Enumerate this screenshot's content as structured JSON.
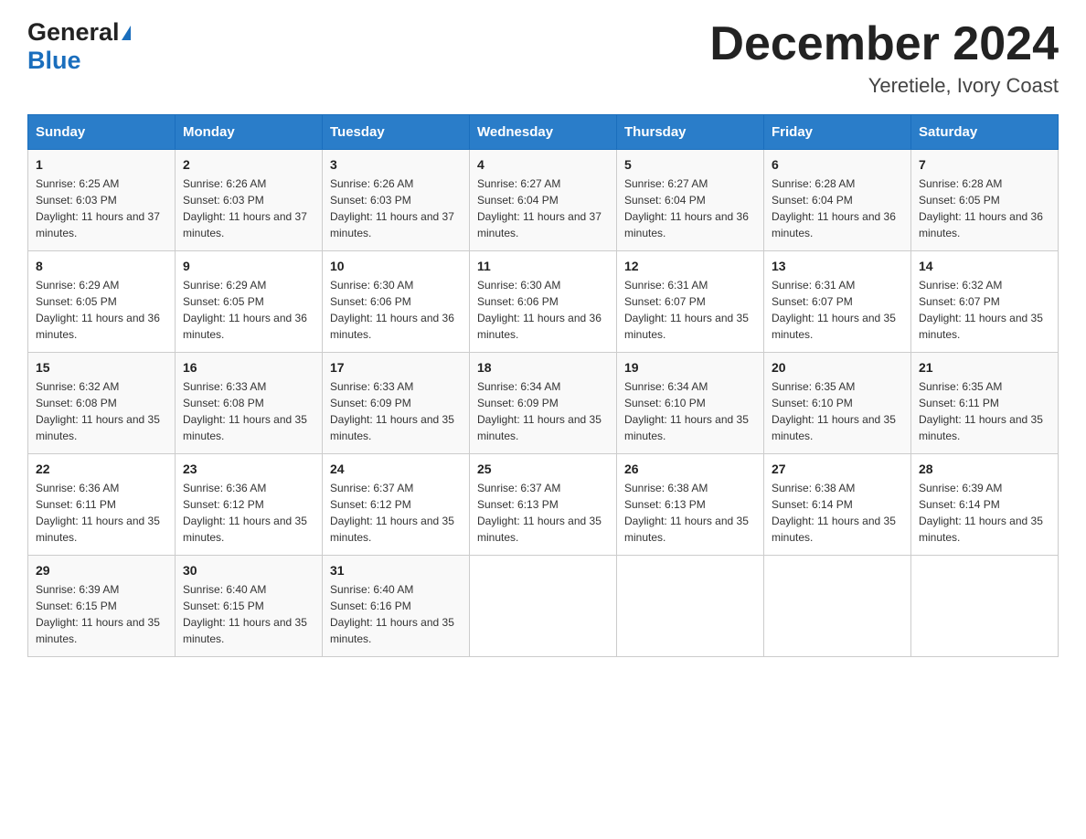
{
  "header": {
    "title": "December 2024",
    "location": "Yeretiele, Ivory Coast",
    "logo_general": "General",
    "logo_blue": "Blue"
  },
  "days_of_week": [
    "Sunday",
    "Monday",
    "Tuesday",
    "Wednesday",
    "Thursday",
    "Friday",
    "Saturday"
  ],
  "weeks": [
    [
      {
        "day": "1",
        "sunrise": "6:25 AM",
        "sunset": "6:03 PM",
        "daylight": "11 hours and 37 minutes."
      },
      {
        "day": "2",
        "sunrise": "6:26 AM",
        "sunset": "6:03 PM",
        "daylight": "11 hours and 37 minutes."
      },
      {
        "day": "3",
        "sunrise": "6:26 AM",
        "sunset": "6:03 PM",
        "daylight": "11 hours and 37 minutes."
      },
      {
        "day": "4",
        "sunrise": "6:27 AM",
        "sunset": "6:04 PM",
        "daylight": "11 hours and 37 minutes."
      },
      {
        "day": "5",
        "sunrise": "6:27 AM",
        "sunset": "6:04 PM",
        "daylight": "11 hours and 36 minutes."
      },
      {
        "day": "6",
        "sunrise": "6:28 AM",
        "sunset": "6:04 PM",
        "daylight": "11 hours and 36 minutes."
      },
      {
        "day": "7",
        "sunrise": "6:28 AM",
        "sunset": "6:05 PM",
        "daylight": "11 hours and 36 minutes."
      }
    ],
    [
      {
        "day": "8",
        "sunrise": "6:29 AM",
        "sunset": "6:05 PM",
        "daylight": "11 hours and 36 minutes."
      },
      {
        "day": "9",
        "sunrise": "6:29 AM",
        "sunset": "6:05 PM",
        "daylight": "11 hours and 36 minutes."
      },
      {
        "day": "10",
        "sunrise": "6:30 AM",
        "sunset": "6:06 PM",
        "daylight": "11 hours and 36 minutes."
      },
      {
        "day": "11",
        "sunrise": "6:30 AM",
        "sunset": "6:06 PM",
        "daylight": "11 hours and 36 minutes."
      },
      {
        "day": "12",
        "sunrise": "6:31 AM",
        "sunset": "6:07 PM",
        "daylight": "11 hours and 35 minutes."
      },
      {
        "day": "13",
        "sunrise": "6:31 AM",
        "sunset": "6:07 PM",
        "daylight": "11 hours and 35 minutes."
      },
      {
        "day": "14",
        "sunrise": "6:32 AM",
        "sunset": "6:07 PM",
        "daylight": "11 hours and 35 minutes."
      }
    ],
    [
      {
        "day": "15",
        "sunrise": "6:32 AM",
        "sunset": "6:08 PM",
        "daylight": "11 hours and 35 minutes."
      },
      {
        "day": "16",
        "sunrise": "6:33 AM",
        "sunset": "6:08 PM",
        "daylight": "11 hours and 35 minutes."
      },
      {
        "day": "17",
        "sunrise": "6:33 AM",
        "sunset": "6:09 PM",
        "daylight": "11 hours and 35 minutes."
      },
      {
        "day": "18",
        "sunrise": "6:34 AM",
        "sunset": "6:09 PM",
        "daylight": "11 hours and 35 minutes."
      },
      {
        "day": "19",
        "sunrise": "6:34 AM",
        "sunset": "6:10 PM",
        "daylight": "11 hours and 35 minutes."
      },
      {
        "day": "20",
        "sunrise": "6:35 AM",
        "sunset": "6:10 PM",
        "daylight": "11 hours and 35 minutes."
      },
      {
        "day": "21",
        "sunrise": "6:35 AM",
        "sunset": "6:11 PM",
        "daylight": "11 hours and 35 minutes."
      }
    ],
    [
      {
        "day": "22",
        "sunrise": "6:36 AM",
        "sunset": "6:11 PM",
        "daylight": "11 hours and 35 minutes."
      },
      {
        "day": "23",
        "sunrise": "6:36 AM",
        "sunset": "6:12 PM",
        "daylight": "11 hours and 35 minutes."
      },
      {
        "day": "24",
        "sunrise": "6:37 AM",
        "sunset": "6:12 PM",
        "daylight": "11 hours and 35 minutes."
      },
      {
        "day": "25",
        "sunrise": "6:37 AM",
        "sunset": "6:13 PM",
        "daylight": "11 hours and 35 minutes."
      },
      {
        "day": "26",
        "sunrise": "6:38 AM",
        "sunset": "6:13 PM",
        "daylight": "11 hours and 35 minutes."
      },
      {
        "day": "27",
        "sunrise": "6:38 AM",
        "sunset": "6:14 PM",
        "daylight": "11 hours and 35 minutes."
      },
      {
        "day": "28",
        "sunrise": "6:39 AM",
        "sunset": "6:14 PM",
        "daylight": "11 hours and 35 minutes."
      }
    ],
    [
      {
        "day": "29",
        "sunrise": "6:39 AM",
        "sunset": "6:15 PM",
        "daylight": "11 hours and 35 minutes."
      },
      {
        "day": "30",
        "sunrise": "6:40 AM",
        "sunset": "6:15 PM",
        "daylight": "11 hours and 35 minutes."
      },
      {
        "day": "31",
        "sunrise": "6:40 AM",
        "sunset": "6:16 PM",
        "daylight": "11 hours and 35 minutes."
      },
      null,
      null,
      null,
      null
    ]
  ]
}
